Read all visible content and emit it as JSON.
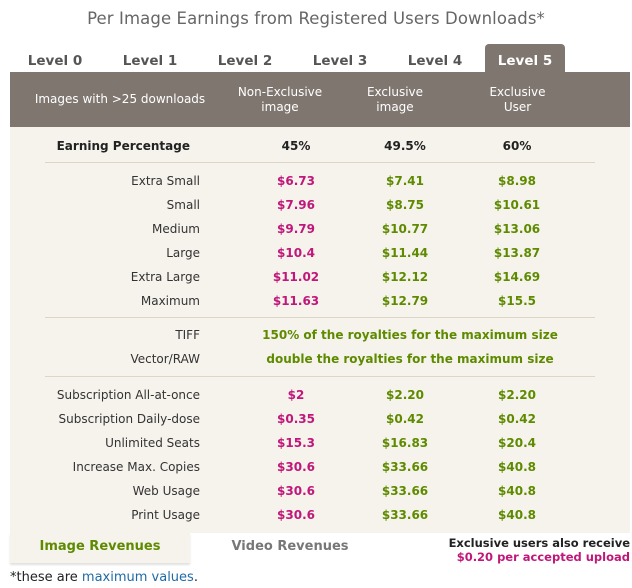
{
  "title": "Per Image Earnings from Registered Users Downloads*",
  "levels": [
    {
      "label": "Level 0"
    },
    {
      "label": "Level 1"
    },
    {
      "label": "Level 2"
    },
    {
      "label": "Level 3"
    },
    {
      "label": "Level 4"
    },
    {
      "label": "Level 5",
      "active": true
    }
  ],
  "header": {
    "col0": "Images with >25 downloads",
    "col1_l1": "Non-Exclusive",
    "col1_l2": "image",
    "col2_l1": "Exclusive",
    "col2_l2": "image",
    "col3_l1": "Exclusive",
    "col3_l2": "User"
  },
  "earning": {
    "label": "Earning Percentage",
    "v1": "45%",
    "v2": "49.5%",
    "v3": "60%"
  },
  "sizes": [
    {
      "label": "Extra Small",
      "v1": "$6.73",
      "v2": "$7.41",
      "v3": "$8.98"
    },
    {
      "label": "Small",
      "v1": "$7.96",
      "v2": "$8.75",
      "v3": "$10.61"
    },
    {
      "label": "Medium",
      "v1": "$9.79",
      "v2": "$10.77",
      "v3": "$13.06"
    },
    {
      "label": "Large",
      "v1": "$10.4",
      "v2": "$11.44",
      "v3": "$13.87"
    },
    {
      "label": "Extra Large",
      "v1": "$11.02",
      "v2": "$12.12",
      "v3": "$14.69"
    },
    {
      "label": "Maximum",
      "v1": "$11.63",
      "v2": "$12.79",
      "v3": "$15.5"
    }
  ],
  "special": [
    {
      "label": "TIFF",
      "note": "150% of the royalties for the maximum size"
    },
    {
      "label": "Vector/RAW",
      "note": "double the royalties for the maximum size"
    }
  ],
  "licenses": [
    {
      "label": "Subscription All-at-once",
      "v1": "$2",
      "v2": "$2.20",
      "v3": "$2.20"
    },
    {
      "label": "Subscription Daily-dose",
      "v1": "$0.35",
      "v2": "$0.42",
      "v3": "$0.42"
    },
    {
      "label": "Unlimited Seats",
      "v1": "$15.3",
      "v2": "$16.83",
      "v3": "$20.4"
    },
    {
      "label": "Increase Max. Copies",
      "v1": "$30.6",
      "v2": "$33.66",
      "v3": "$40.8"
    },
    {
      "label": "Web Usage",
      "v1": "$30.6",
      "v2": "$33.66",
      "v3": "$40.8"
    },
    {
      "label": "Print Usage",
      "v1": "$30.6",
      "v2": "$33.66",
      "v3": "$40.8"
    }
  ],
  "bottom_tabs": {
    "image": "Image Revenues",
    "video": "Video Revenues"
  },
  "note": {
    "line1": "Exclusive users also receive",
    "line2": "$0.20 per accepted upload"
  },
  "footnote": {
    "prefix": "*these are ",
    "link": "maximum values",
    "suffix": "."
  },
  "colors": {
    "header_bg": "#7f7670",
    "panel_bg": "#f6f3ec",
    "non_exclusive": "#c0177a",
    "exclusive": "#5e8a00"
  }
}
